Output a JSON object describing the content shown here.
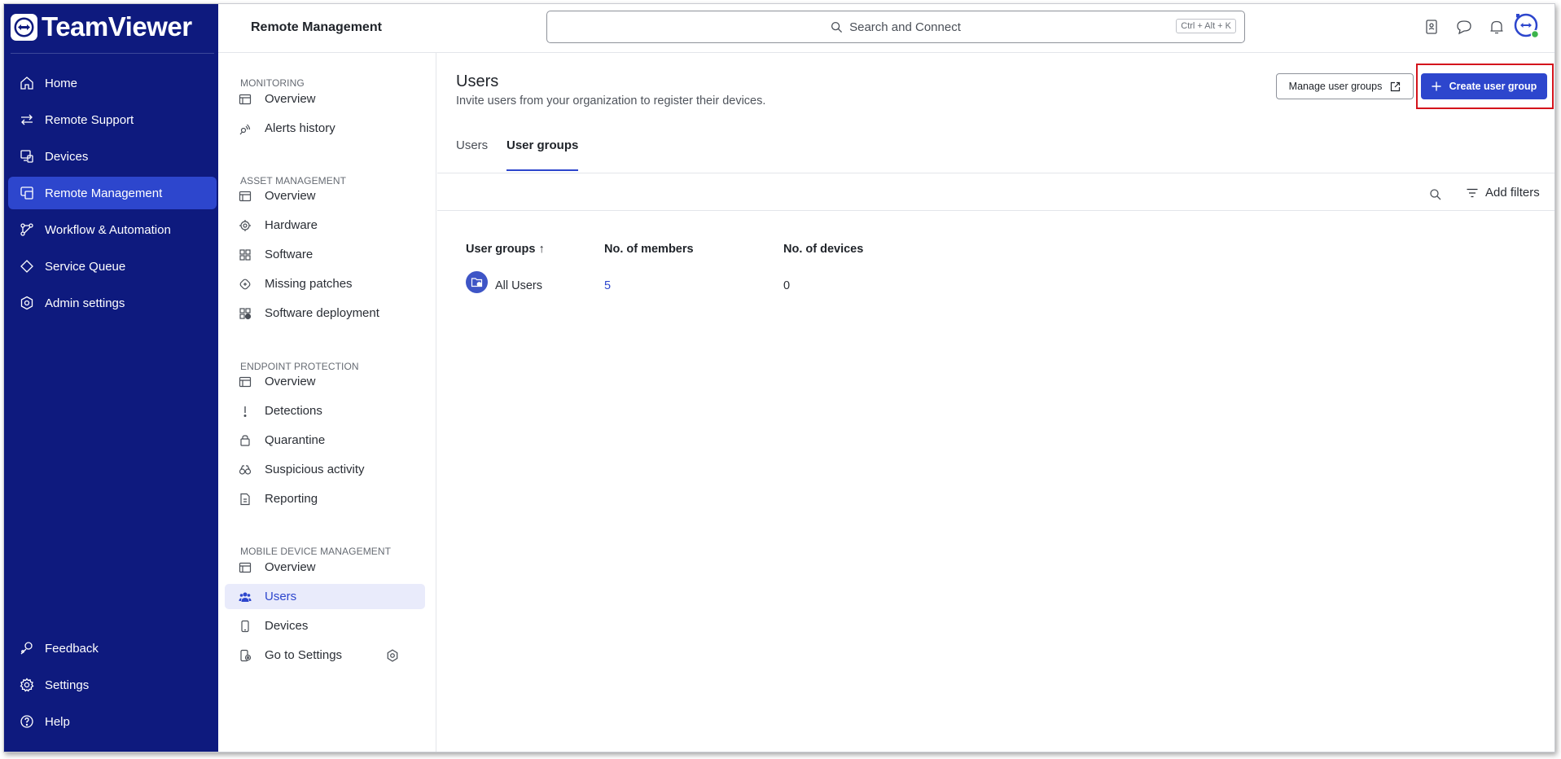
{
  "app": {
    "logo_text": "TeamViewer"
  },
  "nav": {
    "items": [
      {
        "label": "Home",
        "icon": "home-icon"
      },
      {
        "label": "Remote Support",
        "icon": "arrows-icon"
      },
      {
        "label": "Devices",
        "icon": "devices-icon"
      },
      {
        "label": "Remote Management",
        "icon": "remote-management-icon",
        "active": true
      },
      {
        "label": "Workflow & Automation",
        "icon": "workflow-icon"
      },
      {
        "label": "Service Queue",
        "icon": "tag-icon"
      },
      {
        "label": "Admin settings",
        "icon": "admin-icon"
      }
    ],
    "bottom": [
      {
        "label": "Feedback",
        "icon": "feedback-icon"
      },
      {
        "label": "Settings",
        "icon": "gear-icon"
      },
      {
        "label": "Help",
        "icon": "help-icon"
      }
    ]
  },
  "header": {
    "title": "Remote Management",
    "search_placeholder": "Search and Connect",
    "shortcut": "Ctrl + Alt + K"
  },
  "subnav": {
    "sections": [
      {
        "title": "MONITORING",
        "items": [
          "Overview",
          "Alerts history"
        ]
      },
      {
        "title": "ASSET MANAGEMENT",
        "items": [
          "Overview",
          "Hardware",
          "Software",
          "Missing patches",
          "Software deployment"
        ]
      },
      {
        "title": "ENDPOINT PROTECTION",
        "items": [
          "Overview",
          "Detections",
          "Quarantine",
          "Suspicious activity",
          "Reporting"
        ]
      },
      {
        "title": "MOBILE DEVICE MANAGEMENT",
        "items": [
          "Overview",
          "Users",
          "Devices",
          "Go to Settings"
        ]
      }
    ]
  },
  "main": {
    "title": "Users",
    "subtitle": "Invite users from your organization to register their devices.",
    "manage_button": "Manage user groups",
    "create_button": "Create user group",
    "tabs": [
      "Users",
      "User groups"
    ],
    "active_tab": "User groups",
    "add_filters": "Add filters",
    "table": {
      "columns": [
        "User groups",
        "No. of members",
        "No. of devices"
      ],
      "sort_indicator": "↑",
      "rows": [
        {
          "name": "All Users",
          "members": "5",
          "devices": "0"
        }
      ]
    }
  },
  "colors": {
    "nav_bg": "#0e1a7e",
    "accent": "#2d46cd",
    "highlight": "#d4141c"
  }
}
